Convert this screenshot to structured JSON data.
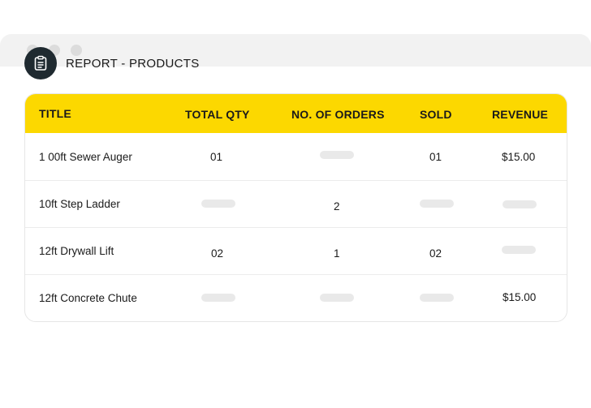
{
  "report": {
    "title": "REPORT - PRODUCTS"
  },
  "table": {
    "columns": [
      "TITLE",
      "TOTAL QTY",
      "NO. OF ORDERS",
      "SOLD",
      "REVENUE"
    ],
    "rows": [
      {
        "title": "1 00ft Sewer Auger",
        "total_qty": "01",
        "orders": null,
        "sold": "01",
        "revenue": "$15.00"
      },
      {
        "title": "10ft Step Ladder",
        "total_qty": null,
        "orders": "2",
        "sold": null,
        "revenue": null
      },
      {
        "title": "12ft Drywall Lift",
        "total_qty": "02",
        "orders": "1",
        "sold": "02",
        "revenue": null
      },
      {
        "title": "12ft Concrete Chute",
        "total_qty": null,
        "orders": null,
        "sold": null,
        "revenue": "$15.00"
      }
    ]
  },
  "colors": {
    "accent": "#fcd800",
    "icon_bg": "#1f2a30",
    "placeholder": "#e9e9e9"
  },
  "icons": {
    "report": "clipboard-icon"
  }
}
